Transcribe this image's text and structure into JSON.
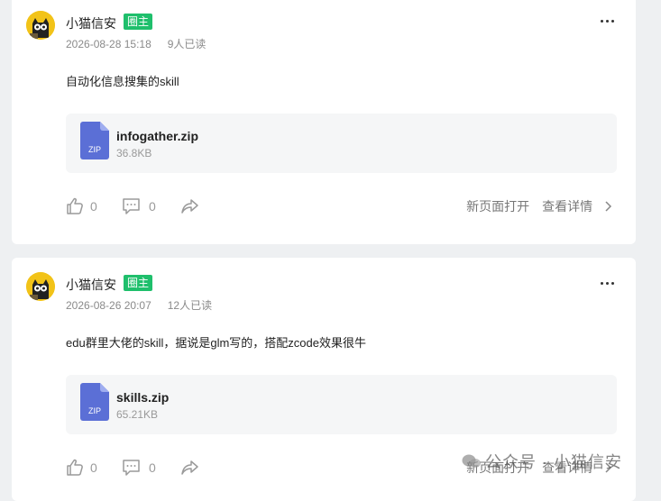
{
  "posts": [
    {
      "author": "小猫信安",
      "badge": "圈主",
      "date": "2026-08-28 15:18",
      "reads": "9人已读",
      "content": "自动化信息搜集的skill",
      "file": {
        "name": "infogather.zip",
        "size": "36.8KB",
        "type": "ZIP"
      },
      "likes": "0",
      "comments": "0",
      "open_new_page": "新页面打开",
      "view_details": "查看详情"
    },
    {
      "author": "小猫信安",
      "badge": "圈主",
      "date": "2026-08-26 20:07",
      "reads": "12人已读",
      "content": "edu群里大佬的skill，据说是glm写的，搭配zcode效果很牛",
      "file": {
        "name": "skills.zip",
        "size": "65.21KB",
        "type": "ZIP"
      },
      "likes": "0",
      "comments": "0",
      "open_new_page": "新页面打开",
      "view_details": "查看详情"
    }
  ],
  "watermark": "公众号 · 小猫信安",
  "colors": {
    "badge": "#1fbf6c",
    "file_icon": "#5b6fd6",
    "background": "#eef0f2"
  },
  "icons": [
    "more-icon",
    "like-icon",
    "comment-icon",
    "share-icon",
    "chevron-right-icon",
    "zip-file-icon"
  ]
}
